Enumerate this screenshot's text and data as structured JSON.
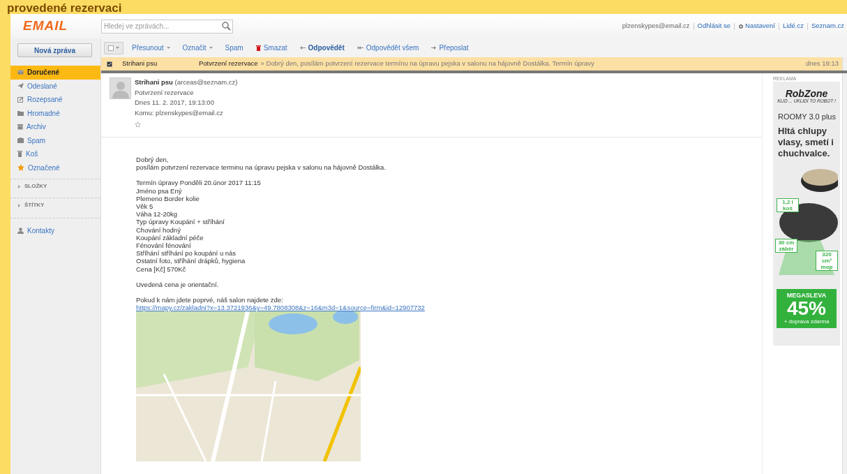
{
  "banner_title": "provedené rezervaci",
  "logo": "EMAIL",
  "search": {
    "placeholder": "Hledej ve zprávách..."
  },
  "account_links": [
    {
      "kind": "text",
      "label": "plzenskypes@email.cz"
    },
    {
      "kind": "link",
      "label": "Odhlásit se"
    },
    {
      "kind": "settings",
      "label": "Nastavení"
    },
    {
      "kind": "link",
      "label": "Lidé.cz"
    },
    {
      "kind": "link",
      "label": "Seznam.cz"
    }
  ],
  "compose_button": "Nová zpráva",
  "folders": [
    {
      "kind": "inbox",
      "label": "Doručené",
      "selected": true
    },
    {
      "kind": "sent",
      "label": "Odeslané",
      "selected": false
    },
    {
      "kind": "drafts",
      "label": "Rozepsané",
      "selected": false
    },
    {
      "kind": "folder",
      "label": "Hromadné",
      "selected": false
    },
    {
      "kind": "archive",
      "label": "Archiv",
      "selected": false
    },
    {
      "kind": "spam",
      "label": "Spam",
      "selected": false
    },
    {
      "kind": "trash",
      "label": "Koš",
      "selected": false
    },
    {
      "kind": "star",
      "label": "Označené",
      "selected": false
    }
  ],
  "sections": [
    {
      "label": "SLOŽKY",
      "expanded": false
    },
    {
      "label": "ŠTÍTKY",
      "expanded": false
    }
  ],
  "contacts": "Kontakty",
  "toolbar": [
    {
      "kind": "menu",
      "label": "Přesunout"
    },
    {
      "kind": "menu",
      "label": "Označit"
    },
    {
      "kind": "plain",
      "label": "Spam"
    },
    {
      "kind": "delete",
      "label": "Smazat"
    },
    {
      "kind": "reply",
      "label": "Odpovědět"
    },
    {
      "kind": "reply_all",
      "label": "Odpovědět všem"
    },
    {
      "kind": "forward",
      "label": "Přeposlat"
    }
  ],
  "messages": [
    {
      "checked": true,
      "selected": true,
      "sender": "Strihani psu",
      "subject": "Potvrzení rezervace",
      "preview": "» Dobrý den, posílám potvrzení rezervace termínu na úpravu pejska v salonu na hájovně Dostálka.  Termín úpravy",
      "time": "dnes 19:13"
    }
  ],
  "email": {
    "sender_name": "Strihani psu",
    "sender_address": "(arceas@seznam.cz)",
    "subject": "Potvrzení rezervace",
    "date": "Dnes 11. 2. 2017, 19:13:00",
    "to": "Komu: plzenskypes@email.cz",
    "starred": false,
    "paragraphs": [
      [
        "Dobrý den,",
        "posílám potvrzení rezervace terminu na úpravu pejska v salonu na hájovně Dostálka."
      ],
      [
        "Termín úpravy Ponděli 20.únor 2017 11:15",
        "Jméno psa Ený",
        "Plemeno Border kolie",
        "Věk 5",
        "Váha 12-20kg",
        "Typ úpravy Koupání + stříhání",
        "Chování hodný",
        "Koupání základní péče",
        "Fénování fénování",
        "Stříhání stříhání po koupání u nás",
        "Ostatní foto, stříhání drápků, hygiena",
        "Cena [Kč] 570Kč"
      ],
      [
        "Uvedená cena je orientační."
      ],
      [
        "Pokud k nám jdete poprvé, náš salon najdete zde:"
      ]
    ],
    "link": "https://mapy.cz/zakladni?x=13.3721936&y=49.7808308&z=16&m3d=1&source=firm&id=12907732"
  },
  "ad": {
    "label": "REKLAMA",
    "brand": "RobZone",
    "tagline": "KLID ... UKLIDÍ TO ROBOT !",
    "model": "ROOMY 3.0 plus",
    "headline": "Hltá chlupy vlasy, smetí i chuchvalce.",
    "callouts": [
      "1,2 l koš",
      "30 cm záběr",
      "320 cm² mop"
    ],
    "promo": "MEGASLEVA",
    "discount": "45%",
    "promo_note": "+ doprava zdarma"
  }
}
